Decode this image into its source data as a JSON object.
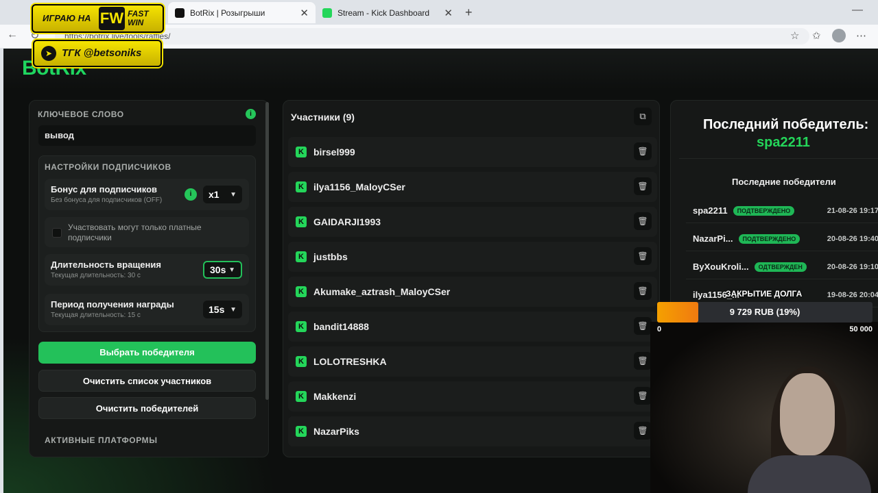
{
  "browser": {
    "tabs": [
      {
        "title": "BotRix | Розыгрыши",
        "active": true
      },
      {
        "title": "Stream - Kick Dashboard",
        "active": false
      }
    ],
    "url": "https://botrix.live/tools/raffles/"
  },
  "overlay": {
    "promo_prefix": "ИГРАЮ НА",
    "promo_brand": "FW",
    "promo_brand_sub": "FAST WIN",
    "telegram": "ТГК @betsoniks"
  },
  "app": {
    "logo": "BotRix"
  },
  "settings": {
    "keyword_label": "КЛЮЧЕВОЕ СЛОВО",
    "keyword_value": "вывод",
    "subscriber_section": "НАСТРОЙКИ ПОДПИСЧИКОВ",
    "bonus_title": "Бонус для подписчиков",
    "bonus_sub": "Без бонуса для подписчиков (OFF)",
    "bonus_value": "x1",
    "paid_only": "Участвовать могут только платные подписчики",
    "spin_title": "Длительность вращения",
    "spin_sub": "Текущая длительность: 30 с",
    "spin_value": "30s",
    "claim_title": "Период получения награды",
    "claim_sub": "Текущая длительность: 15 с",
    "claim_value": "15s",
    "pick_winner": "Выбрать победителя",
    "clear_participants": "Очистить список участников",
    "clear_winners": "Очистить победителей",
    "platforms_label": "АКТИВНЫЕ ПЛАТФОРМЫ"
  },
  "participants": {
    "header": "Участники (9)",
    "list": [
      "birsel999",
      "ilya1156_MaloyCSer",
      "GAIDARJI1993",
      "justbbs",
      "Akumake_aztrash_MaloyCSer",
      "bandit14888",
      "LOLOTRESHKA",
      "Makkenzi",
      "NazarPiks"
    ]
  },
  "winners": {
    "last_title": "Последний победитель:",
    "last_name": "spa2211",
    "recent_title": "Последние победители",
    "list": [
      {
        "name": "spa2211",
        "badge": "ПОДТВЕРЖДЕНО",
        "date": "21-08-26 19:17"
      },
      {
        "name": "NazarPi...",
        "badge": "ПОДТВЕРЖДЕНО",
        "date": "20-08-26 19:40"
      },
      {
        "name": "ByXouKroli...",
        "badge": "ОДТВЕРЖДЕН",
        "date": "20-08-26 19:10"
      },
      {
        "name": "ilya1156_...",
        "badge": "",
        "date": "19-08-26 20:04"
      }
    ]
  },
  "debt_widget": {
    "title": "ЗАКРЫТИЕ ДОЛГА",
    "value": "9 729 RUB (19%)",
    "progress": 0.19,
    "min": "0",
    "max": "50 000"
  }
}
